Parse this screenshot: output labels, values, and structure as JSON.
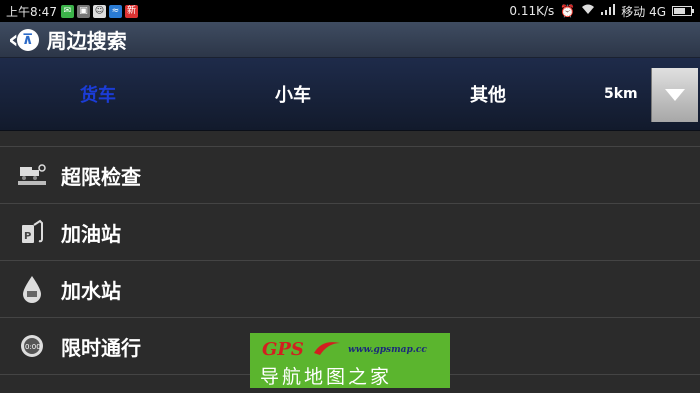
{
  "status_bar": {
    "time": "上午8:47",
    "notification_icons": [
      "wechat-icon",
      "photo-icon",
      "qq-icon",
      "wifi-app-icon",
      "news-icon"
    ],
    "speed": "0.11K/s",
    "carrier": "移动 4G"
  },
  "title_bar": {
    "title": "周边搜索"
  },
  "tabs": [
    {
      "label": "货车",
      "active": true
    },
    {
      "label": "小车",
      "active": false
    },
    {
      "label": "其他",
      "active": false
    }
  ],
  "range": {
    "value": "5km"
  },
  "list": [
    {
      "label": "超限检查",
      "icon": "truck-scale-icon"
    },
    {
      "label": "加油站",
      "icon": "fuel-station-icon"
    },
    {
      "label": "加水站",
      "icon": "water-drop-icon"
    },
    {
      "label": "限时通行",
      "icon": "clock-restriction-icon"
    }
  ],
  "watermark": {
    "brand": "GPS",
    "url": "www.gpsmap.cc",
    "name": "导航地图之家"
  },
  "colors": {
    "active_tab": "#1b3cd6",
    "watermark_bg": "#5bb52e"
  }
}
